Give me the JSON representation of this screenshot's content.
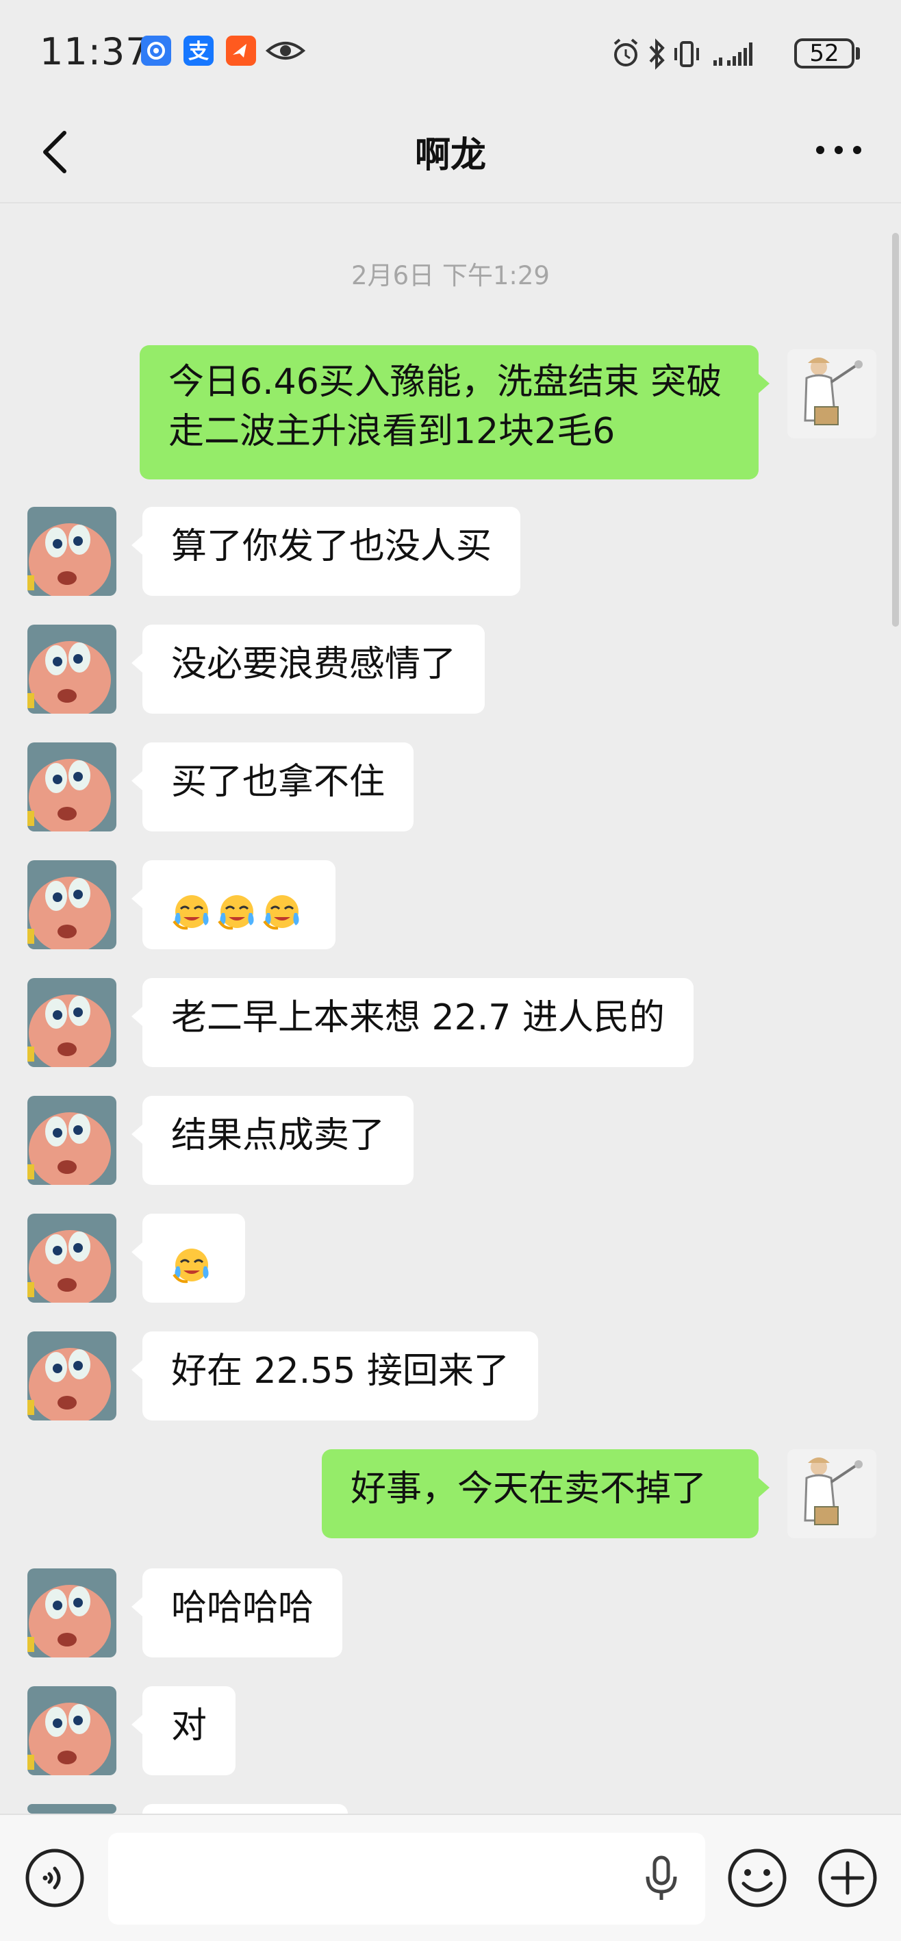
{
  "status_bar": {
    "time": "11:37",
    "battery": "52",
    "app_icons": [
      "app-blue-icon",
      "alipay-icon",
      "orange-app-icon",
      "eye-icon"
    ],
    "right_icons": [
      "alarm-icon",
      "bluetooth-icon",
      "vibrate-icon",
      "signal-icon",
      "battery-icon"
    ]
  },
  "header": {
    "title": "啊龙"
  },
  "chat": {
    "timestamp": "2月6日 下午1:29",
    "messages": [
      {
        "side": "out",
        "text": "今日6.46买入豫能，洗盘结束 突破走二波主升浪看到12块2毛6"
      },
      {
        "side": "in",
        "text": "算了你发了也没人买"
      },
      {
        "side": "in",
        "text": "没必要浪费感情了"
      },
      {
        "side": "in",
        "text": "买了也拿不住"
      },
      {
        "side": "in",
        "text": "",
        "emoji": [
          "face-with-tears-emoji",
          "face-with-tears-emoji",
          "face-with-tears-emoji"
        ]
      },
      {
        "side": "in",
        "text": "老二早上本来想 22.7 进人民的"
      },
      {
        "side": "in",
        "text": "结果点成卖了"
      },
      {
        "side": "in",
        "text": "",
        "emoji": [
          "face-with-tears-emoji"
        ]
      },
      {
        "side": "in",
        "text": "好在 22.55 接回来了"
      },
      {
        "side": "out",
        "text": "好事，今天在卖不掉了"
      },
      {
        "side": "in",
        "text": "哈哈哈哈"
      },
      {
        "side": "in",
        "text": "对"
      }
    ]
  },
  "colors": {
    "background": "#ededed",
    "outgoing_bubble": "#95ec69",
    "incoming_bubble": "#ffffff",
    "timestamp": "#a6a6a6"
  }
}
